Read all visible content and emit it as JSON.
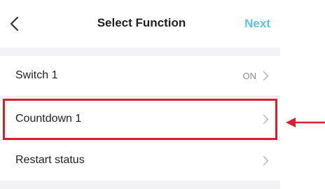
{
  "navbar": {
    "back_icon": "chevron-left-icon",
    "title": "Select Function",
    "next_label": "Next",
    "next_color": "#5cc6da"
  },
  "rows": [
    {
      "label": "Switch 1",
      "value": "ON",
      "icon": "chevron-right-icon"
    },
    {
      "label": "Countdown 1",
      "value": "",
      "icon": "chevron-right-icon"
    },
    {
      "label": "Restart status",
      "value": "",
      "icon": "chevron-right-icon"
    }
  ],
  "annotation": {
    "highlight_color": "#d9202f",
    "arrow_icon": "arrow-left-icon"
  }
}
